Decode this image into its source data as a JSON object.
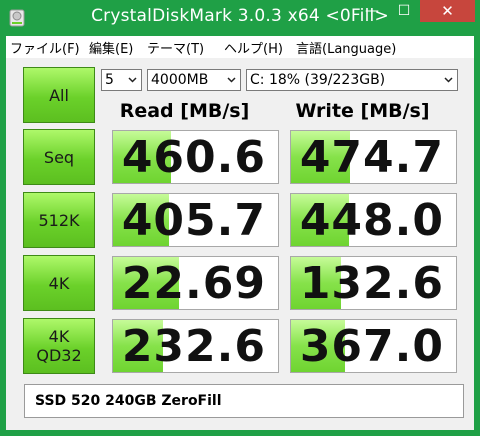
{
  "window": {
    "title": "CrystalDiskMark 3.0.3 x64 <0Fill>",
    "min_symbol": "—",
    "max_symbol": "☐",
    "close_symbol": "✕"
  },
  "menu": [
    {
      "label": "ファイル(F)"
    },
    {
      "label": "編集(E)"
    },
    {
      "label": "テーマ(T)"
    },
    {
      "label": "ヘルプ(H)"
    },
    {
      "label": "言語(Language)"
    }
  ],
  "controls": {
    "all_label": "All",
    "count_value": "5",
    "size_value": "4000MB",
    "drive_value": "C: 18% (39/223GB)"
  },
  "headers": {
    "read": "Read [MB/s]",
    "write": "Write [MB/s]"
  },
  "rows": [
    {
      "label": "Seq",
      "read": "460.6",
      "write": "474.7",
      "read_level": 0.35,
      "write_level": 0.36
    },
    {
      "label": "512K",
      "read": "405.7",
      "write": "448.0",
      "read_level": 0.34,
      "write_level": 0.35
    },
    {
      "label": "4K",
      "read": "22.69",
      "write": "132.6",
      "read_level": 0.4,
      "write_level": 0.3
    },
    {
      "label": "4K\nQD32",
      "read": "232.6",
      "write": "367.0",
      "read_level": 0.3,
      "write_level": 0.33
    }
  ],
  "comment": "SSD 520 240GB ZeroFill",
  "colors": {
    "title_bar": "#1fa046",
    "close_button": "#c7463d",
    "value_fill": "#86e24a"
  }
}
